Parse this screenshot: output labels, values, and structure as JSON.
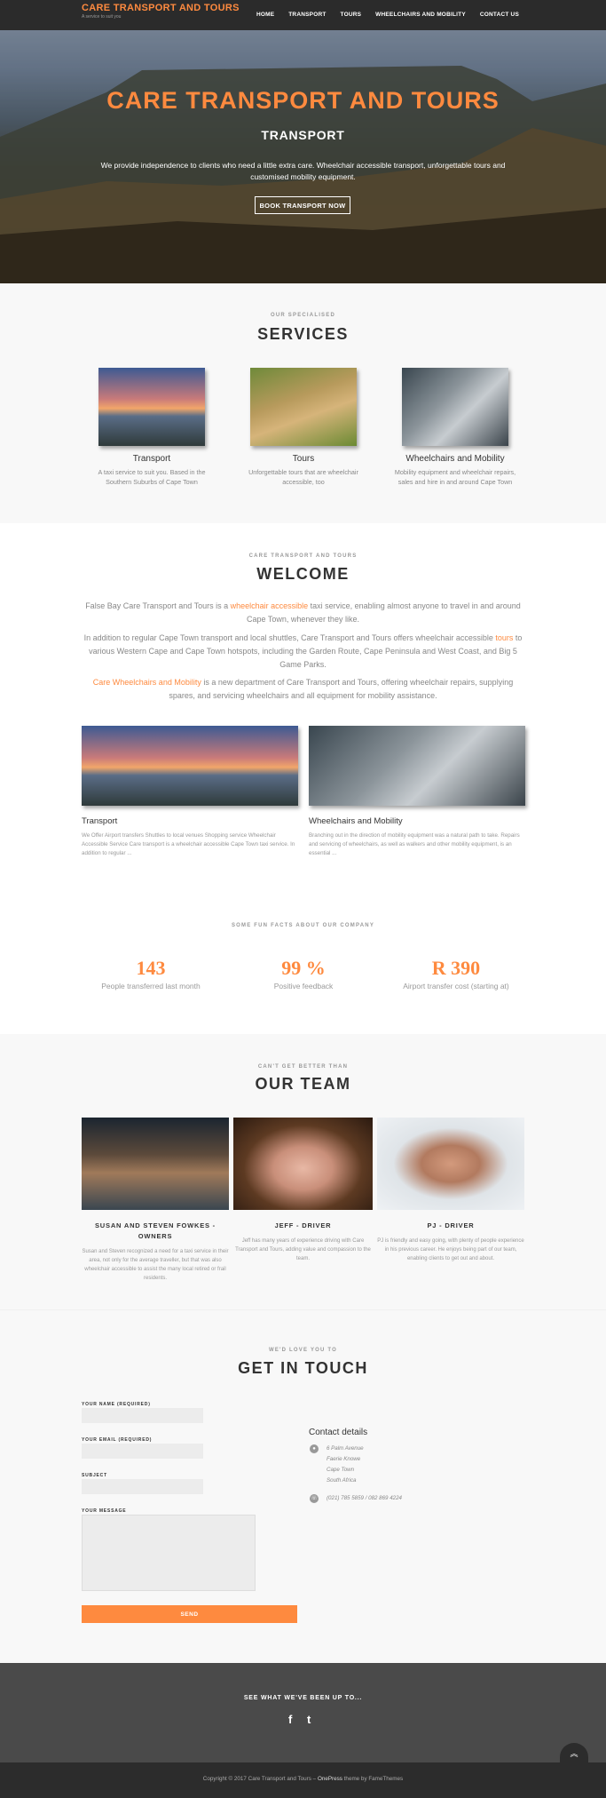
{
  "header": {
    "brand_title": "CARE TRANSPORT AND TOURS",
    "brand_tagline": "A service to suit you",
    "nav": [
      "HOME",
      "TRANSPORT",
      "TOURS",
      "WHEELCHAIRS AND MOBILITY",
      "CONTACT US"
    ]
  },
  "hero": {
    "title": "CARE TRANSPORT AND TOURS",
    "subtitle": "TRANSPORT",
    "description": "We provide independence to clients who need a little extra care. Wheelchair accessible transport, unforgettable tours and customised mobility equipment.",
    "button": "BOOK TRANSPORT NOW"
  },
  "services": {
    "small": "OUR SPECIALISED",
    "title": "SERVICES",
    "items": [
      {
        "name": "Transport",
        "desc": "A taxi service to suit you. Based in the Southern Suburbs of Cape Town"
      },
      {
        "name": "Tours",
        "desc": "Unforgettable tours that are wheelchair accessible, too"
      },
      {
        "name": "Wheelchairs and Mobility",
        "desc": "Mobility equipment and wheelchair repairs, sales and hire in and around Cape Town"
      }
    ]
  },
  "welcome": {
    "small": "CARE TRANSPORT AND TOURS",
    "title": "WELCOME",
    "p1_a": "False Bay Care Transport and Tours is a ",
    "p1_link": "wheelchair accessible",
    "p1_b": " taxi service, enabling almost anyone to travel in and around Cape Town, whenever they like.",
    "p2_a": "In addition to regular Cape Town transport and local shuttles, Care Transport and Tours offers wheelchair accessible ",
    "p2_link": "tours",
    "p2_b": " to various Western Cape and Cape Town hotspots, including the Garden Route, Cape Peninsula and West Coast, and Big 5 Game Parks.",
    "p3_link": "Care Wheelchairs and Mobility",
    "p3_b": " is a new department of Care Transport and Tours, offering wheelchair repairs, supplying spares, and servicing wheelchairs and all equipment for mobility assistance.",
    "cards": [
      {
        "title": "Transport",
        "desc": "We Offer   Airport transfers Shuttles to local venues Shopping service   Wheelchair Accessible Service   Care transport is a wheelchair accessible Cape Town taxi service. In addition to regular ..."
      },
      {
        "title": "Wheelchairs and Mobility",
        "desc": "Branching out in the direction of mobility equipment was a natural path to take. Repairs and servicing of wheelchairs, as well as walkers and other mobility equipment, is an essential ..."
      }
    ]
  },
  "facts": {
    "small": "SOME FUN FACTS ABOUT OUR COMPANY",
    "items": [
      {
        "num": "143",
        "label": "People transferred last month"
      },
      {
        "num": "99 %",
        "label": "Positive feedback"
      },
      {
        "num": "R 390",
        "label": "Airport transfer cost (starting at)"
      }
    ]
  },
  "team": {
    "small": "CAN'T GET BETTER THAN",
    "title": "OUR TEAM",
    "members": [
      {
        "name": "SUSAN AND STEVEN FOWKES - OWNERS",
        "desc": "Susan and Steven recognized a need for a taxi service in their area, not only for the average traveller, but that was also wheelchair accessible to assist the many local retired or frail residents."
      },
      {
        "name": "JEFF - DRIVER",
        "desc": "Jeff has many years of experience driving with Care Transport and Tours, adding value and compassion to the team."
      },
      {
        "name": "PJ - DRIVER",
        "desc": "PJ is friendly and easy going, with plenty of people experience in his previous career. He enjoys being part of our team, enabling clients to get out and about."
      }
    ]
  },
  "contact": {
    "small": "WE'D LOVE YOU TO",
    "title": "GET IN TOUCH",
    "label_name": "YOUR NAME (REQUIRED)",
    "label_email": "YOUR EMAIL (REQUIRED)",
    "label_subject": "SUBJECT",
    "label_message": "YOUR MESSAGE",
    "send": "SEND",
    "details_title": "Contact details",
    "address": [
      "6 Palm Avenue",
      "Faerie Knowe",
      "Cape Town",
      "South Africa"
    ],
    "phone": "(021) 785 5859 / 082 869 4224"
  },
  "footer": {
    "title": "SEE WHAT WE'VE BEEN UP TO...",
    "copyright": "Copyright © 2017 Care Transport and Tours – ",
    "theme_name": "OnePress",
    "theme_suffix": " theme by FameThemes"
  },
  "icons": {
    "facebook": "f",
    "twitter": "t",
    "back_to_top": "︽",
    "location": "●",
    "phone": "☏"
  },
  "colors": {
    "accent": "#fe8a3f",
    "header": "#2b2b2b",
    "footer": "#4a4a4a"
  }
}
